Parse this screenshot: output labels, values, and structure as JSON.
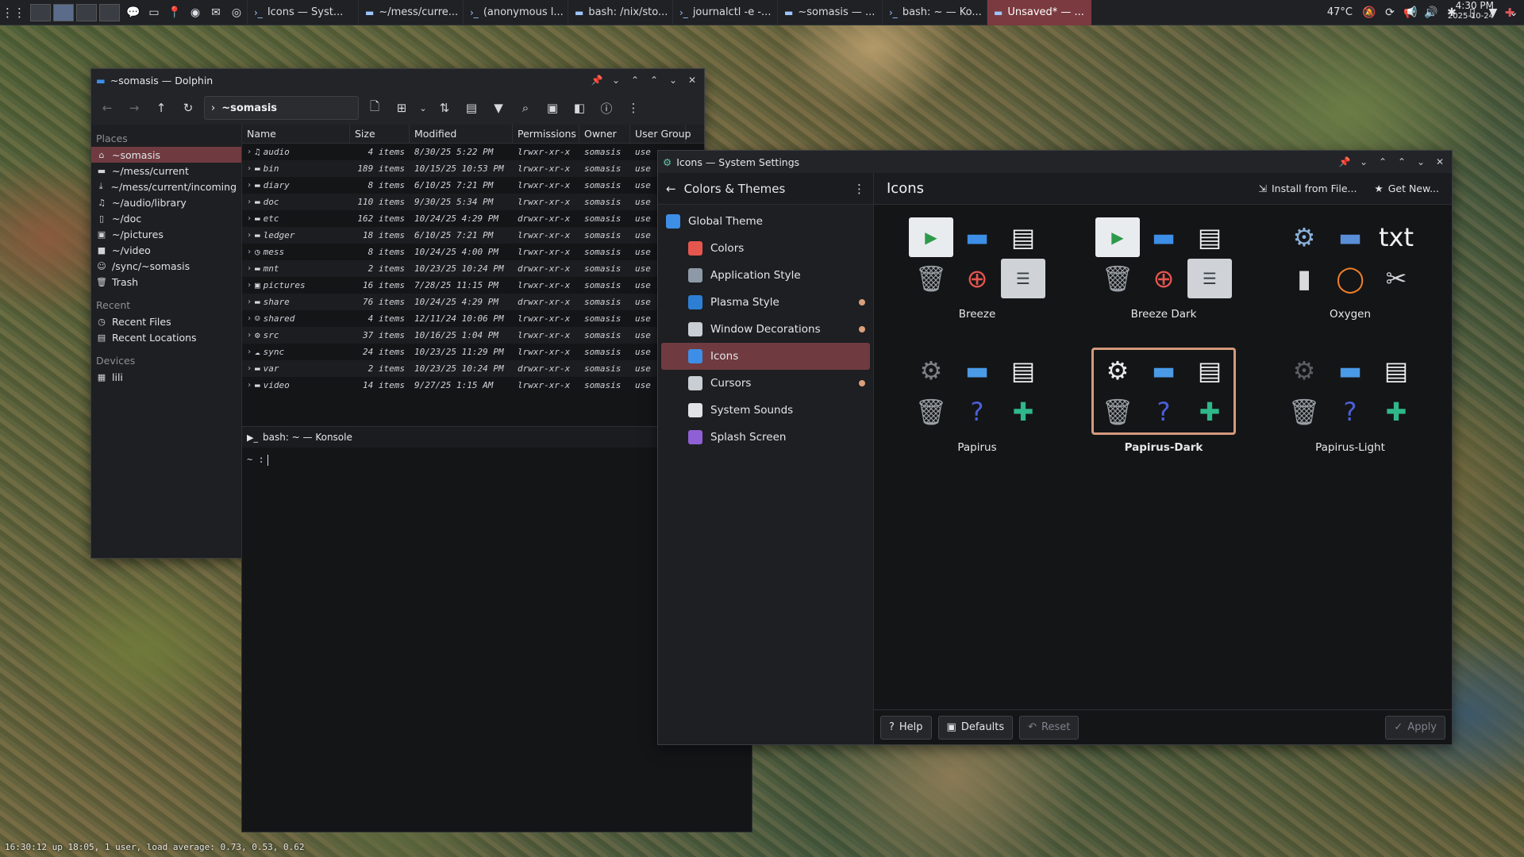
{
  "taskbar": {
    "tasks": [
      {
        "label": "Icons — Syst...",
        "active": false
      },
      {
        "label": "~/mess/curre...",
        "active": false
      },
      {
        "label": "(anonymous l...",
        "active": false
      },
      {
        "label": "bash: /nix/sto...",
        "active": false
      },
      {
        "label": "journalctl -e -...",
        "active": false
      },
      {
        "label": "~somasis — ...",
        "active": false
      },
      {
        "label": "bash: ~ — Ko...",
        "active": false
      },
      {
        "label": "Unsaved* — ...",
        "active": true
      }
    ],
    "temperature": "47°C",
    "time": "4:30 PM",
    "date": "2025-10-24"
  },
  "dolphin": {
    "title": "~somasis — Dolphin",
    "breadcrumb": "~somasis",
    "places_header": "Places",
    "places": [
      {
        "label": "~somasis",
        "icon": "home-icon",
        "selected": true
      },
      {
        "label": "~/mess/current",
        "icon": "drive-icon"
      },
      {
        "label": "~/mess/current/incoming",
        "icon": "download-icon"
      },
      {
        "label": "~/audio/library",
        "icon": "music-icon"
      },
      {
        "label": "~/doc",
        "icon": "document-icon"
      },
      {
        "label": "~/pictures",
        "icon": "image-icon"
      },
      {
        "label": "~/video",
        "icon": "video-icon"
      },
      {
        "label": "/sync/~somasis",
        "icon": "user-icon"
      },
      {
        "label": "Trash",
        "icon": "trash-icon"
      }
    ],
    "recent_header": "Recent",
    "recent": [
      {
        "label": "Recent Files",
        "icon": "clock-icon"
      },
      {
        "label": "Recent Locations",
        "icon": "folder-clock-icon"
      }
    ],
    "devices_header": "Devices",
    "devices": [
      {
        "label": "lili",
        "icon": "device-icon"
      }
    ],
    "columns": [
      "Name",
      "Size",
      "Modified",
      "Permissions",
      "Owner",
      "User Group"
    ],
    "files": [
      {
        "name": "audio",
        "size": "4 items",
        "modified": "8/30/25 5:22 PM",
        "perm": "lrwxr-xr-x",
        "owner": "somasis",
        "group": "use"
      },
      {
        "name": "bin",
        "size": "189 items",
        "modified": "10/15/25 10:53 PM",
        "perm": "lrwxr-xr-x",
        "owner": "somasis",
        "group": "use"
      },
      {
        "name": "diary",
        "size": "8 items",
        "modified": "6/10/25 7:21 PM",
        "perm": "lrwxr-xr-x",
        "owner": "somasis",
        "group": "use"
      },
      {
        "name": "doc",
        "size": "110 items",
        "modified": "9/30/25 5:34 PM",
        "perm": "lrwxr-xr-x",
        "owner": "somasis",
        "group": "use"
      },
      {
        "name": "etc",
        "size": "162 items",
        "modified": "10/24/25 4:29 PM",
        "perm": "drwxr-xr-x",
        "owner": "somasis",
        "group": "use"
      },
      {
        "name": "ledger",
        "size": "18 items",
        "modified": "6/10/25 7:21 PM",
        "perm": "lrwxr-xr-x",
        "owner": "somasis",
        "group": "use"
      },
      {
        "name": "mess",
        "size": "8 items",
        "modified": "10/24/25 4:00 PM",
        "perm": "lrwxr-xr-x",
        "owner": "somasis",
        "group": "use"
      },
      {
        "name": "mnt",
        "size": "2 items",
        "modified": "10/23/25 10:24 PM",
        "perm": "drwxr-xr-x",
        "owner": "somasis",
        "group": "use"
      },
      {
        "name": "pictures",
        "size": "16 items",
        "modified": "7/28/25 11:15 PM",
        "perm": "lrwxr-xr-x",
        "owner": "somasis",
        "group": "use"
      },
      {
        "name": "share",
        "size": "76 items",
        "modified": "10/24/25 4:29 PM",
        "perm": "drwxr-xr-x",
        "owner": "somasis",
        "group": "use"
      },
      {
        "name": "shared",
        "size": "4 items",
        "modified": "12/11/24 10:06 PM",
        "perm": "lrwxr-xr-x",
        "owner": "somasis",
        "group": "use"
      },
      {
        "name": "src",
        "size": "37 items",
        "modified": "10/16/25 1:04 PM",
        "perm": "lrwxr-xr-x",
        "owner": "somasis",
        "group": "use"
      },
      {
        "name": "sync",
        "size": "24 items",
        "modified": "10/23/25 11:29 PM",
        "perm": "lrwxr-xr-x",
        "owner": "somasis",
        "group": "use"
      },
      {
        "name": "var",
        "size": "2 items",
        "modified": "10/23/25 10:24 PM",
        "perm": "drwxr-xr-x",
        "owner": "somasis",
        "group": "use"
      },
      {
        "name": "video",
        "size": "14 items",
        "modified": "9/27/25 1:15 AM",
        "perm": "lrwxr-xr-x",
        "owner": "somasis",
        "group": "use"
      }
    ]
  },
  "konsole": {
    "title": "bash: ~ — Konsole",
    "prompt": "~ :"
  },
  "settings": {
    "title": "Icons — System Settings",
    "section": "Colors & Themes",
    "page": "Icons",
    "install_label": "Install from File...",
    "get_new_label": "Get New...",
    "nav": [
      {
        "label": "Global Theme",
        "color": "#3d8ee6",
        "top": true
      },
      {
        "label": "Colors",
        "color": "#e5564f"
      },
      {
        "label": "Application Style",
        "color": "#8d99a6"
      },
      {
        "label": "Plasma Style",
        "color": "#2d7fd6",
        "dot": true
      },
      {
        "label": "Window Decorations",
        "color": "#c9ced4",
        "dot": true
      },
      {
        "label": "Icons",
        "color": "#3d8ee6",
        "selected": true
      },
      {
        "label": "Cursors",
        "color": "#c9ced4",
        "dot": true
      },
      {
        "label": "System Sounds",
        "color": "#e0e3e6"
      },
      {
        "label": "Splash Screen",
        "color": "#8f5fd6"
      }
    ],
    "themes": [
      {
        "name": "Breeze",
        "selected": false
      },
      {
        "name": "Breeze Dark",
        "selected": false
      },
      {
        "name": "Oxygen",
        "selected": false
      },
      {
        "name": "Papirus",
        "selected": false
      },
      {
        "name": "Papirus-Dark",
        "selected": true
      },
      {
        "name": "Papirus-Light",
        "selected": false
      }
    ],
    "help_label": "Help",
    "defaults_label": "Defaults",
    "reset_label": "Reset",
    "apply_label": "Apply"
  },
  "statusline": "16:30:12  up  18:05,  1 user,  load average: 0.73, 0.53, 0.62"
}
